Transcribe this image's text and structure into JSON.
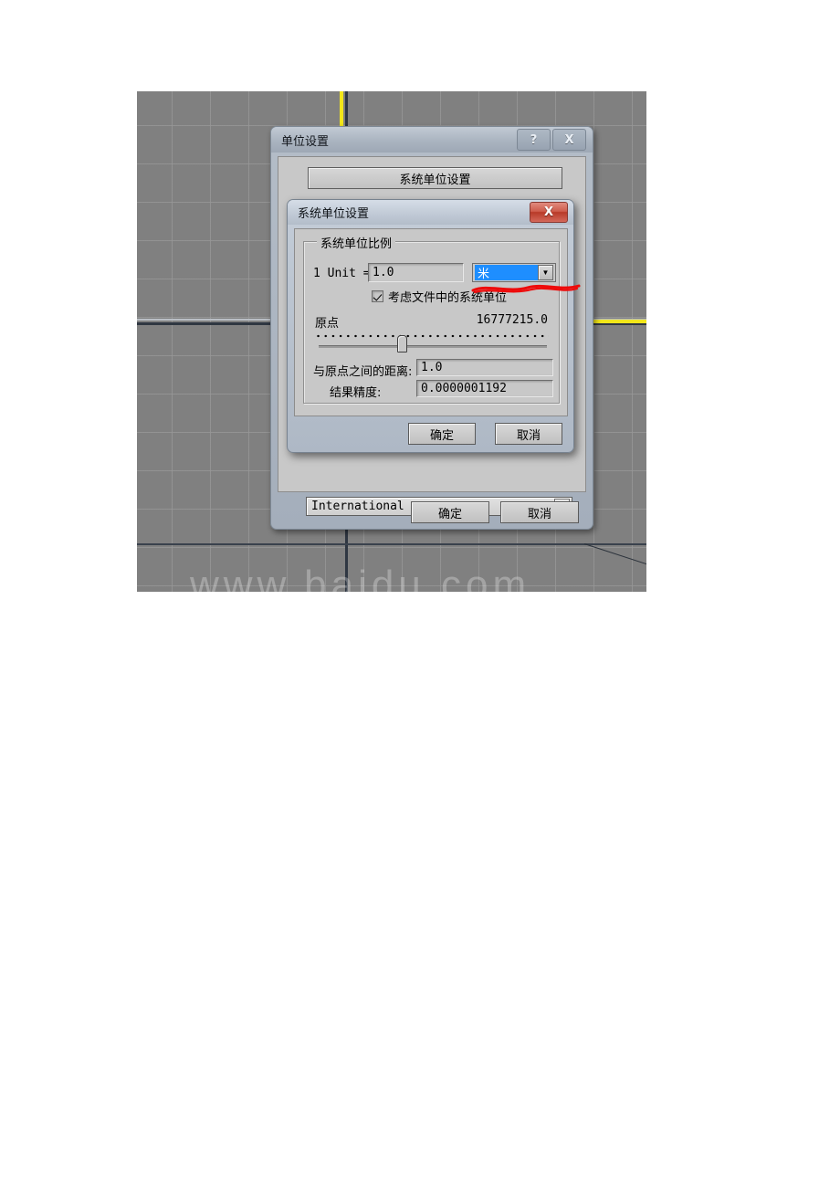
{
  "viewport": {
    "name": "3ds-max-viewport",
    "watermark": "www.baidu.com"
  },
  "units_dialog": {
    "title": "单位设置",
    "help_button": "?",
    "close_button": "X",
    "system_unit_setup_button": "系统单位设置",
    "international_combo": {
      "value": "International",
      "arrow": "▼"
    },
    "ok_button": "确定",
    "cancel_button": "取消"
  },
  "system_units_dialog": {
    "title": "系统单位设置",
    "close_button": "X",
    "scale_group": {
      "label": "系统单位比例",
      "unit_row_label": "1 Unit =",
      "unit_value": "1.0",
      "unit_type": "米",
      "unit_type_arrow": "▼",
      "respect_file_units_label": "考虑文件中的系统单位",
      "respect_file_units_checked": true,
      "origin_label": "原点",
      "origin_value": "16777215.0",
      "distance_label": "与原点之间的距离:",
      "distance_value": "1.0",
      "precision_label": "结果精度:",
      "precision_value": "0.0000001192"
    },
    "ok_button": "确定",
    "cancel_button": "取消"
  },
  "colors": {
    "viewport_bg": "#808080",
    "grid_line": "#969696",
    "axis_yellow": "#f2e61a",
    "axis_dark": "#2f3742",
    "dialog_face": "#c8c8c8",
    "titlebar": "#b4bdc8",
    "selection_blue": "#1e8eff",
    "close_red": "#cf5d4c",
    "annotation_red": "#ee0a0a"
  }
}
